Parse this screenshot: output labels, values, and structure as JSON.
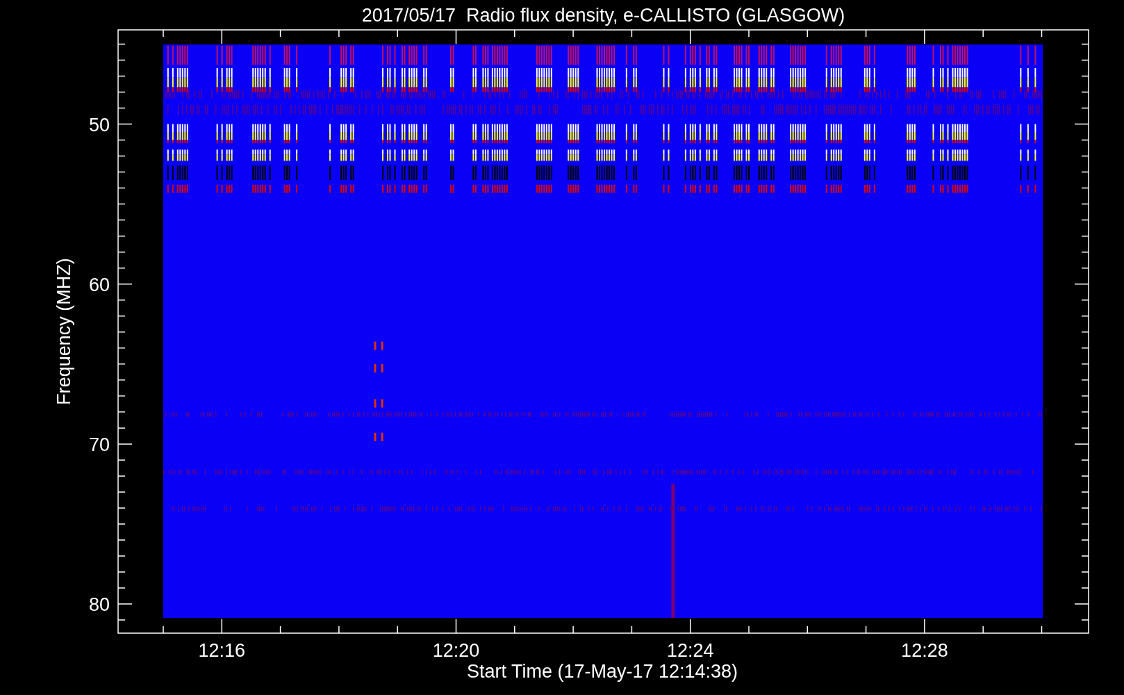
{
  "plot": {
    "title": "2017/05/17  Radio flux density, e-CALLISTO (GLASGOW)",
    "x_axis": {
      "label": "Start Time (17-May-17 12:14:38)",
      "ticks": [
        "12:16",
        "12:20",
        "12:24",
        "12:28"
      ]
    },
    "y_axis": {
      "label": "Frequency (MHZ)",
      "ticks": [
        "50",
        "60",
        "70",
        "80"
      ]
    }
  }
}
